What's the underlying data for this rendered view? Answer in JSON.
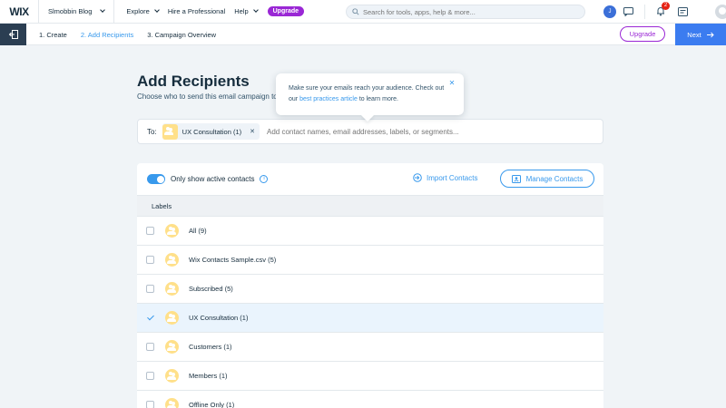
{
  "topbar": {
    "logo": "WIX",
    "site_name": "Slmobbin Blog",
    "nav": [
      {
        "label": "Explore"
      },
      {
        "label": "Hire a Professional"
      },
      {
        "label": "Help"
      }
    ],
    "upgrade_label": "Upgrade",
    "search_placeholder": "Search for tools, apps, help & more...",
    "avatar_initial": "J",
    "notification_count": "2"
  },
  "stepbar": {
    "steps": [
      "1. Create",
      "2. Add Recipients",
      "3. Campaign Overview"
    ],
    "active_step": 1,
    "upgrade_label": "Upgrade",
    "next_label": "Next"
  },
  "main": {
    "title": "Add Recipients",
    "subtitle": "Choose who to send this email campaign to."
  },
  "tooltip": {
    "text_before": "Make sure your emails reach your audience. Check out our ",
    "link": "best practices article",
    "text_after": " to learn more."
  },
  "to_field": {
    "label": "To:",
    "chip": "UX Consultation (1)",
    "placeholder": "Add contact names, email addresses, labels, or segments..."
  },
  "panel": {
    "toggle_label": "Only show active contacts",
    "import_label": "Import Contacts",
    "manage_label": "Manage Contacts",
    "labels_header": "Labels",
    "rows": [
      {
        "label": "All (9)",
        "selected": false
      },
      {
        "label": "Wix Contacts Sample.csv (5)",
        "selected": false
      },
      {
        "label": "Subscribed (5)",
        "selected": false
      },
      {
        "label": "UX Consultation (1)",
        "selected": true
      },
      {
        "label": "Customers (1)",
        "selected": false
      },
      {
        "label": "Members (1)",
        "selected": false
      },
      {
        "label": "Offline Only (1)",
        "selected": false
      }
    ]
  },
  "colors": {
    "accent": "#3899ec",
    "premium": "#9a27d5",
    "next_button": "#3b7cf0"
  }
}
